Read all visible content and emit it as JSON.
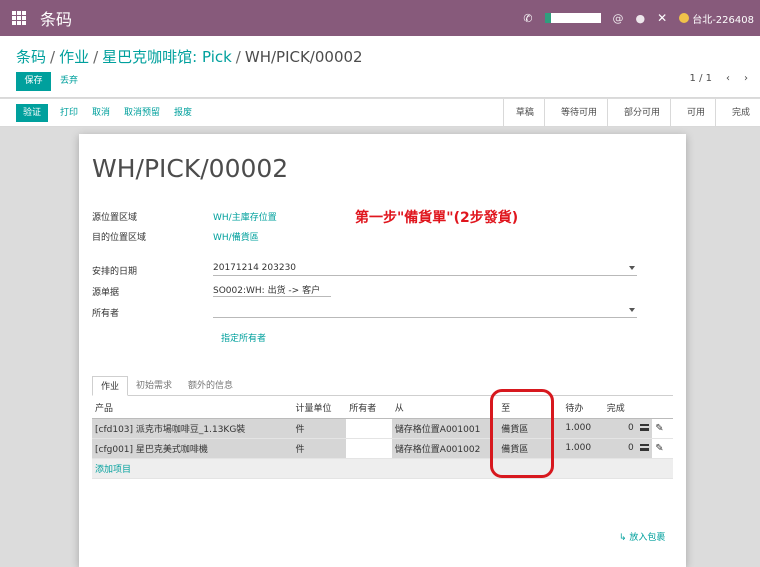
{
  "navbar": {
    "app_title": "条码",
    "user_label": "台北-226408",
    "icons": [
      "apps-grid-icon",
      "phone-icon",
      "at-icon",
      "chat-icon",
      "close-x-icon",
      "user-avatar-icon"
    ],
    "brand_color": "#875a7b"
  },
  "breadcrumb": {
    "items": [
      "条码",
      "作业",
      "星巴克咖啡馆: Pick"
    ],
    "current": "WH/PICK/00002",
    "separator": "/"
  },
  "buttons": {
    "save": "保存",
    "discard": "丢弃"
  },
  "pager": {
    "value": "1 / 1",
    "prev": "‹",
    "next": "›"
  },
  "actions": [
    "验证",
    "打印",
    "取消",
    "取消预留",
    "报废"
  ],
  "stages": [
    "草稿",
    "等待可用",
    "部分可用",
    "可用",
    "完成"
  ],
  "record": {
    "title": "WH/PICK/00002",
    "annotation": "第一步\"備貨單\"(2步發貨)",
    "fields": {
      "source_location": {
        "label": "源位置区域",
        "value": "WH/主庫存位置"
      },
      "dest_location": {
        "label": "目的位置区域",
        "value": "WH/備貨區"
      },
      "scheduled_date": {
        "label": "安排的日期",
        "value": "20171214 203230"
      },
      "source_document": {
        "label": "源单据",
        "value": "SO002:WH: 出货 -> 客户"
      },
      "owner": {
        "label": "所有者",
        "value": ""
      }
    },
    "assign_owner_link": "指定所有者"
  },
  "tabs": [
    "作业",
    "初始需求",
    "额外的信息"
  ],
  "table": {
    "headers": [
      "产品",
      "计量单位",
      "所有者",
      "从",
      "至",
      "待办",
      "完成"
    ],
    "rows": [
      {
        "product": "[cfd103] 派克市場咖啡豆_1.13KG裝",
        "uom": "件",
        "owner": "",
        "from": "儲存格位置A001001",
        "to": "備貨區",
        "todo": "1.000",
        "done": "0"
      },
      {
        "product": "[cfg001] 星巴克美式咖啡機",
        "uom": "件",
        "owner": "",
        "from": "儲存格位置A001002",
        "to": "備貨區",
        "todo": "1.000",
        "done": "0"
      }
    ],
    "add_item": "添加项目"
  },
  "put_in_pack": "↳ 放入包裹",
  "accent_color": "#00a09d",
  "annotation_color": "#e0161e"
}
